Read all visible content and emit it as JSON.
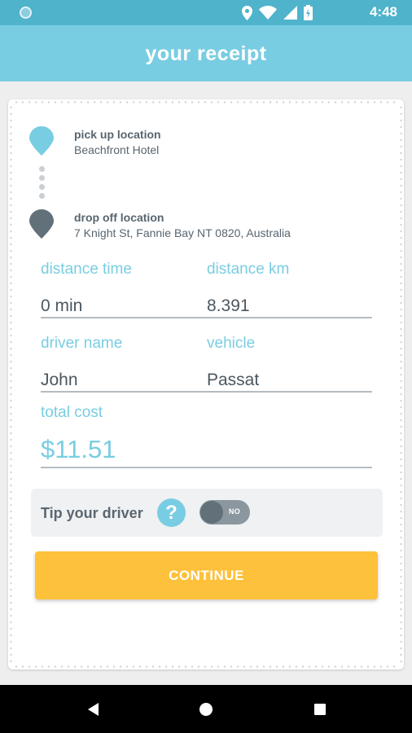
{
  "status_bar": {
    "time": "4:48",
    "icons": [
      "notification-dot-icon",
      "location-icon",
      "wifi-icon",
      "signal-icon",
      "battery-charging-icon"
    ]
  },
  "header": {
    "title": "your receipt"
  },
  "pickup": {
    "label": "pick up location",
    "value": "Beachfront Hotel"
  },
  "dropoff": {
    "label": "drop off location",
    "value": "7 Knight St, Fannie Bay NT 0820, Australia"
  },
  "fields": {
    "distance_time": {
      "label": "distance time",
      "value": "0 min"
    },
    "distance_km": {
      "label": "distance km",
      "value": "8.391"
    },
    "driver_name": {
      "label": "driver name",
      "value": "John"
    },
    "vehicle": {
      "label": "vehicle",
      "value": "Passat"
    },
    "total_cost": {
      "label": "total cost",
      "value": "$11.51"
    }
  },
  "tip": {
    "label": "Tip your driver",
    "help": "?",
    "toggle_text": "NO",
    "toggle_on": false
  },
  "continue_label": "CONTINUE",
  "nav": {
    "icons": [
      "back-icon",
      "home-icon",
      "recents-icon"
    ]
  },
  "colors": {
    "status_bar": "#4fb3cc",
    "header": "#79cde2",
    "accent": "#79cde2",
    "button": "#fec13b",
    "pickup_pin": "#79cde2",
    "dropoff_pin": "#62707a"
  }
}
